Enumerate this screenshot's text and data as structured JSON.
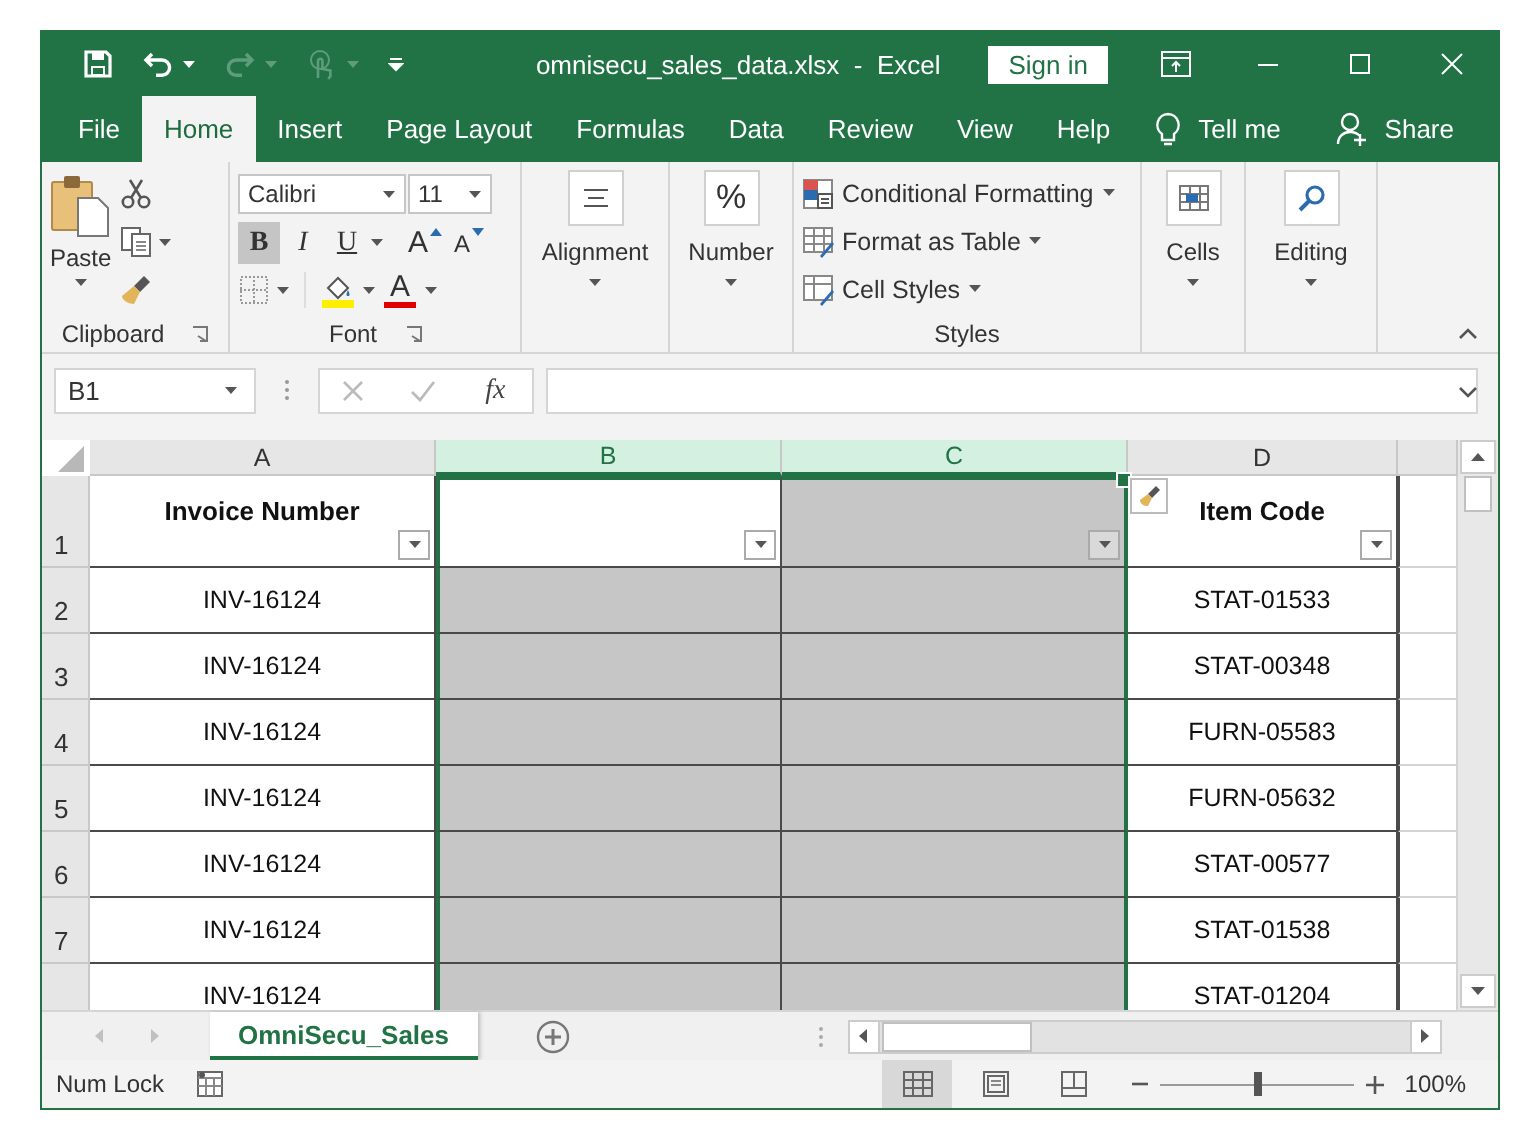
{
  "title_bar": {
    "quick_access": [
      {
        "kind": "save",
        "disabled": false
      },
      {
        "kind": "undo",
        "disabled": false
      },
      {
        "kind": "redo",
        "disabled": true
      },
      {
        "kind": "touch",
        "disabled": true
      }
    ],
    "title": "omnisecu_sales_data.xlsx  -  Excel",
    "sign_in": "Sign in"
  },
  "tabs": [
    {
      "label": "File",
      "selected": false
    },
    {
      "label": "Home",
      "selected": true
    },
    {
      "label": "Insert",
      "selected": false
    },
    {
      "label": "Page Layout",
      "selected": false
    },
    {
      "label": "Formulas",
      "selected": false
    },
    {
      "label": "Data",
      "selected": false
    },
    {
      "label": "Review",
      "selected": false
    },
    {
      "label": "View",
      "selected": false
    },
    {
      "label": "Help",
      "selected": false
    }
  ],
  "tell_me": "Tell me",
  "share": "Share",
  "ribbon": {
    "clipboard": {
      "paste": "Paste",
      "label": "Clipboard"
    },
    "font": {
      "name": "Calibri",
      "size": "11",
      "styles": [
        {
          "kind": "bold",
          "label": "B",
          "pressed": true
        },
        {
          "kind": "italic",
          "label": "I",
          "pressed": false
        },
        {
          "kind": "underline",
          "label": "U",
          "pressed": false
        }
      ],
      "grow": "A",
      "shrink": "A",
      "font_color": "A",
      "label": "Font"
    },
    "alignment": {
      "label": "Alignment"
    },
    "number": {
      "symbol": "%",
      "label": "Number"
    },
    "styles": {
      "items": [
        "Conditional Formatting",
        "Format as Table",
        "Cell Styles"
      ],
      "label": "Styles"
    },
    "cells": {
      "label": "Cells"
    },
    "editing": {
      "label": "Editing"
    }
  },
  "formula_bar": {
    "name_box": "B1",
    "fx": "fx"
  },
  "columns": [
    {
      "letter": "A",
      "selected": false,
      "active": false
    },
    {
      "letter": "B",
      "selected": true,
      "active": true
    },
    {
      "letter": "C",
      "selected": true,
      "active": false
    },
    {
      "letter": "D",
      "selected": false,
      "active": false
    }
  ],
  "rows": [
    {
      "number": "1",
      "kind": "header",
      "cells": [
        {
          "text": "Invoice Number"
        },
        {},
        {},
        {
          "text": "Item Code"
        }
      ]
    },
    {
      "number": "2",
      "kind": "data",
      "cells": [
        {
          "text": "INV-16124"
        },
        {},
        {},
        {
          "text": "STAT-01533"
        }
      ]
    },
    {
      "number": "3",
      "kind": "data",
      "cells": [
        {
          "text": "INV-16124"
        },
        {},
        {},
        {
          "text": "STAT-00348"
        }
      ]
    },
    {
      "number": "4",
      "kind": "data",
      "cells": [
        {
          "text": "INV-16124"
        },
        {},
        {},
        {
          "text": "FURN-05583"
        }
      ]
    },
    {
      "number": "5",
      "kind": "data",
      "cells": [
        {
          "text": "INV-16124"
        },
        {},
        {},
        {
          "text": "FURN-05632"
        }
      ]
    },
    {
      "number": "6",
      "kind": "data",
      "cells": [
        {
          "text": "INV-16124"
        },
        {},
        {},
        {
          "text": "STAT-00577"
        }
      ]
    },
    {
      "number": "7",
      "kind": "data",
      "cells": [
        {
          "text": "INV-16124"
        },
        {},
        {},
        {
          "text": "STAT-01538"
        }
      ]
    },
    {
      "kind": "data",
      "cells": [
        {
          "text": "INV-16124"
        },
        {},
        {},
        {
          "text": "STAT-01204"
        }
      ]
    }
  ],
  "sheet_tabs": [
    {
      "label": "OmniSecu_Sales",
      "selected": true
    }
  ],
  "status_bar": {
    "mode": "Num Lock",
    "views": [
      {
        "kind": "normal",
        "selected": true
      },
      {
        "kind": "page_layout",
        "selected": false
      },
      {
        "kind": "page_break",
        "selected": false
      }
    ],
    "zoom": {
      "level": 0.5,
      "reading": "100%"
    }
  }
}
